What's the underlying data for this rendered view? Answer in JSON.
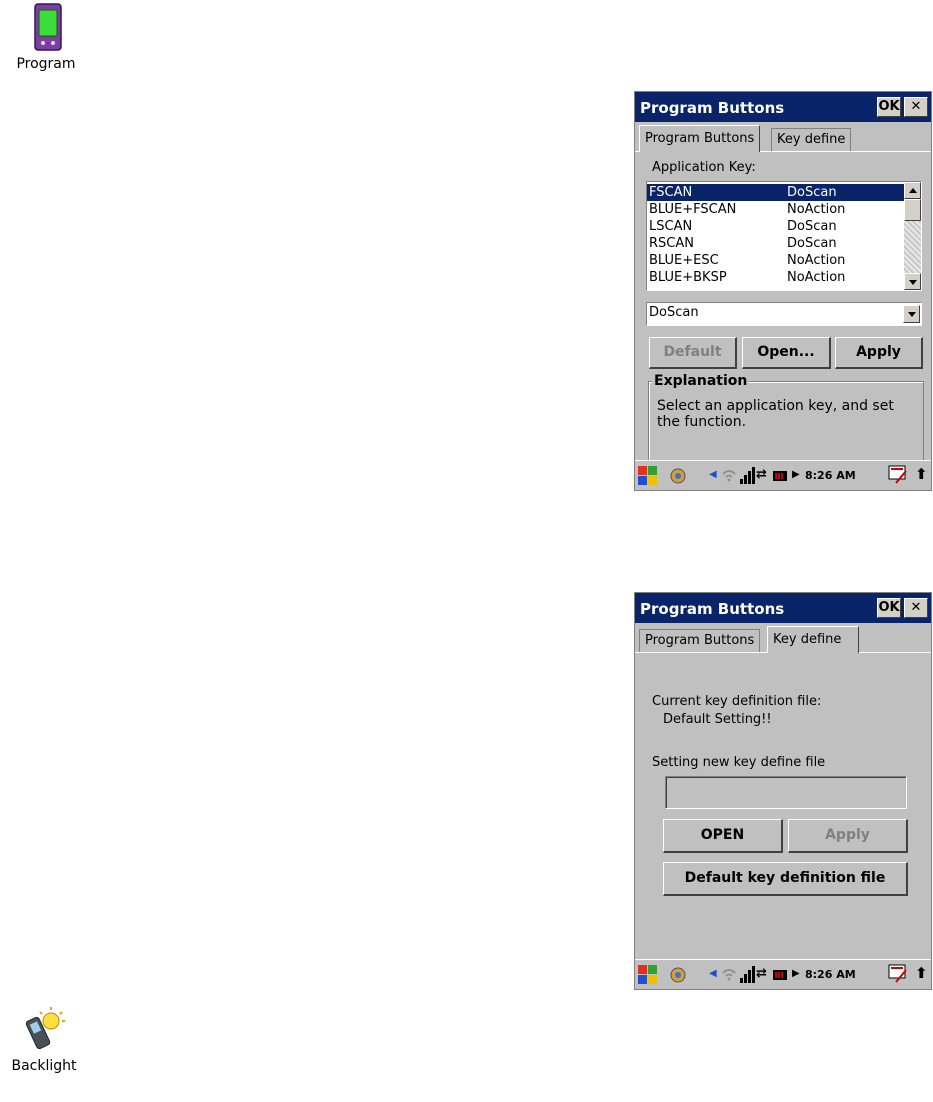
{
  "desktop_icons": [
    {
      "label": "Program"
    },
    {
      "label": "Backlight"
    }
  ],
  "screen1": {
    "title": "Program Buttons",
    "ok_label": "OK",
    "close_label": "✕",
    "tabs": [
      {
        "label": "Program Buttons",
        "active": true
      },
      {
        "label": "Key define",
        "active": false
      }
    ],
    "section_label": "Application Key:",
    "list": [
      {
        "key": "FSCAN",
        "action": "DoScan",
        "selected": true
      },
      {
        "key": "BLUE+FSCAN",
        "action": "NoAction",
        "selected": false
      },
      {
        "key": "LSCAN",
        "action": "DoScan",
        "selected": false
      },
      {
        "key": "RSCAN",
        "action": "DoScan",
        "selected": false
      },
      {
        "key": "BLUE+ESC",
        "action": "NoAction",
        "selected": false
      },
      {
        "key": "BLUE+BKSP",
        "action": "NoAction",
        "selected": false
      }
    ],
    "combo_value": "DoScan",
    "buttons": {
      "default": "Default",
      "open": "Open...",
      "apply": "Apply"
    },
    "explanation_title": "Explanation",
    "explanation_text_line1": "Select an application key, and set",
    "explanation_text_line2": "the function.",
    "time": "8:26 AM"
  },
  "screen2": {
    "title": "Program Buttons",
    "ok_label": "OK",
    "close_label": "✕",
    "tabs": [
      {
        "label": "Program Buttons",
        "active": false
      },
      {
        "label": "Key define",
        "active": true
      }
    ],
    "current_label": "Current key definition file:",
    "current_value": "Default Setting!!",
    "new_label": "Setting new key define file",
    "new_value": "",
    "buttons": {
      "open": "OPEN",
      "apply": "Apply",
      "default_file": "Default key definition file"
    },
    "time": "8:26 AM"
  },
  "colors": {
    "titlebar": "#0a246a",
    "face": "#c0c0c0",
    "selection": "#0a246a"
  }
}
